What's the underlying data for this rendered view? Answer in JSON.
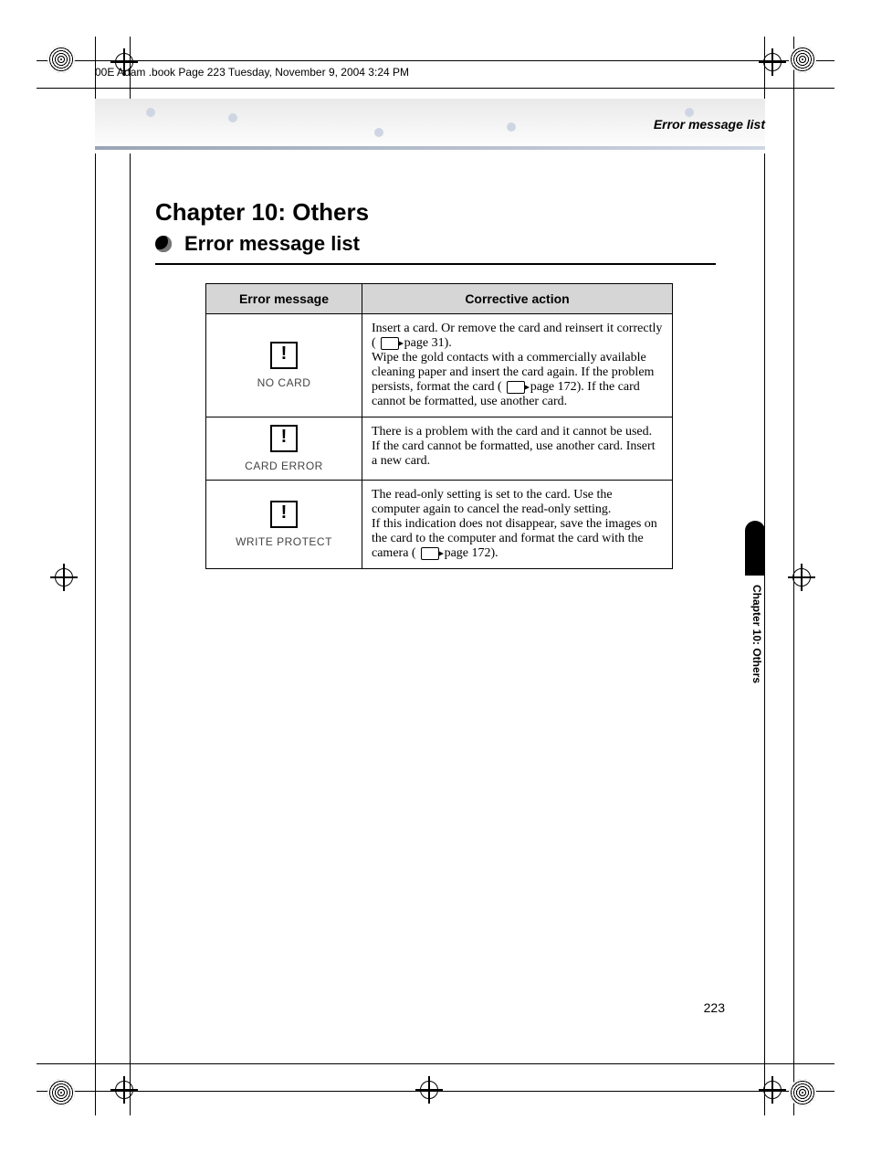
{
  "header_strip": "00E Adam .book  Page 223  Tuesday, November 9, 2004  3:24 PM",
  "running_head": "Error message list",
  "chapter_title": "Chapter 10: Others",
  "section_title": "Error message list",
  "table": {
    "headers": {
      "msg": "Error message",
      "action": "Corrective action"
    },
    "rows": [
      {
        "label": "NO CARD",
        "action_a": "Insert a card. Or remove the card and reinsert it correctly (",
        "ref1": " page 31).",
        "action_b": "Wipe the gold contacts with a commercially available cleaning paper and insert the card again. If the problem persists, format the card (",
        "ref2": " page 172). If the card cannot be formatted, use another card."
      },
      {
        "label": "CARD ERROR",
        "action": "There is a problem with the card and it cannot be used. If the card cannot be formatted, use another card. Insert a new card."
      },
      {
        "label": "WRITE PROTECT",
        "action_a": "The read-only setting is set to the card. Use the computer again to cancel the read-only setting.",
        "action_b": "If this indication does not disappear, save the images on the card to the computer and format the card with the camera (",
        "ref1": " page 172)."
      }
    ]
  },
  "side_tab": "Chapter 10: Others",
  "page_number": "223"
}
